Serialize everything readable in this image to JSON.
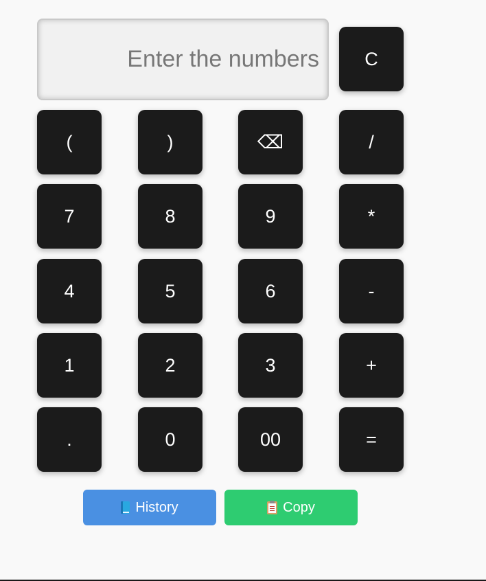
{
  "display": {
    "value": "",
    "placeholder": "Enter the numbers"
  },
  "keys": {
    "clear": "C",
    "open_paren": "(",
    "close_paren": ")",
    "backspace": "⌫",
    "divide": "/",
    "seven": "7",
    "eight": "8",
    "nine": "9",
    "multiply": "*",
    "four": "4",
    "five": "5",
    "six": "6",
    "subtract": "-",
    "one": "1",
    "two": "2",
    "three": "3",
    "add": "+",
    "decimal": ".",
    "zero": "0",
    "double_zero": "00",
    "equals": "="
  },
  "actions": {
    "history_label": "History",
    "history_icon": "book-icon",
    "copy_label": "Copy",
    "copy_icon": "clipboard-icon"
  },
  "colors": {
    "key_background": "#1b1b1b",
    "history_button": "#4a90e2",
    "copy_button": "#2ecc71"
  }
}
